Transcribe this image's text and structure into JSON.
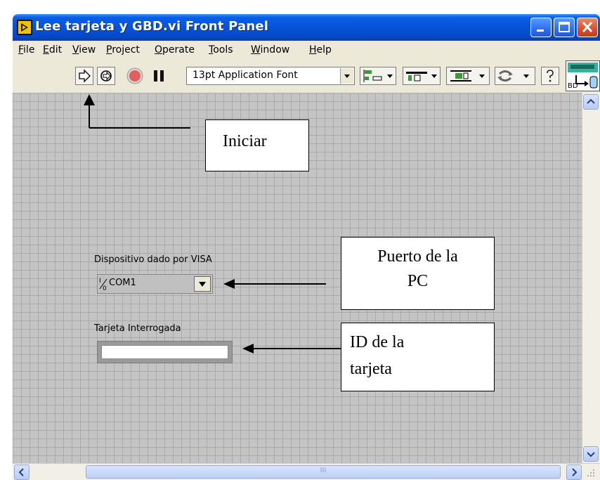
{
  "window": {
    "title": "Lee tarjeta y GBD.vi Front Panel"
  },
  "menu": [
    {
      "underline": "F",
      "rest": "ile"
    },
    {
      "underline": "E",
      "rest": "dit"
    },
    {
      "underline": "V",
      "rest": "iew"
    },
    {
      "underline": "P",
      "rest": "roject"
    },
    {
      "underline": "O",
      "rest": "perate"
    },
    {
      "underline": "T",
      "rest": "ools"
    },
    {
      "underline": "W",
      "rest": "indow"
    },
    {
      "underline": "H",
      "rest": "elp"
    }
  ],
  "toolbar": {
    "font_select": "13pt Application Font"
  },
  "controls": {
    "visa_label": "Dispositivo dado por VISA",
    "visa_io_glyph": "I/0",
    "visa_value": "COM1",
    "tarjeta_label": "Tarjeta Interrogada",
    "tarjeta_value": ""
  },
  "callouts": {
    "iniciar": "Iniciar",
    "puerto_line1": "Puerto de la",
    "puerto_line2": "PC",
    "id_line1": "ID de la",
    "id_line2": "tarjeta"
  },
  "scrollbar": {
    "thumb_grip": "III"
  },
  "colors": {
    "titlebar": "#0653d8",
    "panel_bg": "#c4c4c4",
    "chrome": "#ece9d8",
    "abort_red": "#e06060"
  }
}
